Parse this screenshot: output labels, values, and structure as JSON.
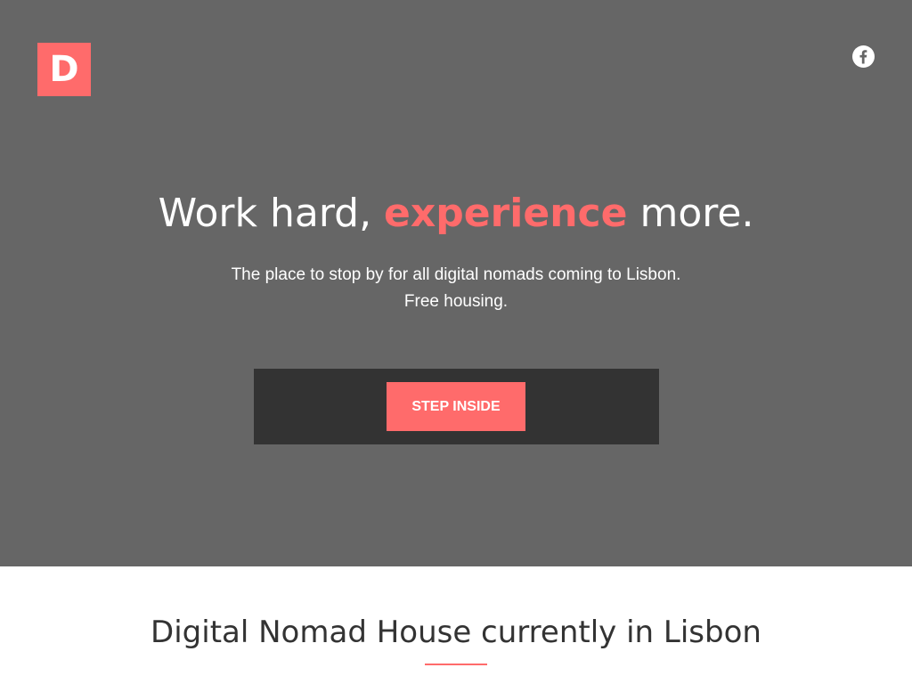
{
  "brand": {
    "logo_letter": "D",
    "logo_color": "#ff6b6b"
  },
  "social": {
    "icon": "facebook-icon",
    "glyph": "f"
  },
  "hero": {
    "background": "#666666",
    "headline_part1": "Work hard, ",
    "headline_accent": "experience",
    "headline_part2": " more.",
    "subtext_line1": "The place to stop by for all digital nomads coming to Lisbon.",
    "subtext_line2": "Free housing.",
    "cta_label": "STEP INSIDE",
    "accent_color": "#ff6b6b"
  },
  "section": {
    "title": "Digital Nomad House currently in Lisbon"
  }
}
